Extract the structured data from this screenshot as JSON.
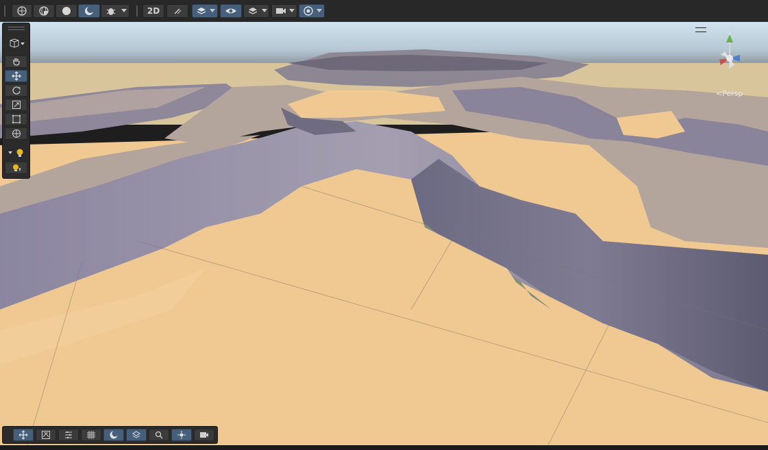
{
  "toolbar": {
    "items": [
      {
        "name": "global-toggle-button",
        "icon": "globe-icon",
        "active": false
      },
      {
        "name": "shading-wireframe-button",
        "icon": "wireframe-sphere-icon",
        "active": false
      },
      {
        "name": "shading-shaded-button",
        "icon": "shaded-sphere-icon",
        "active": false
      },
      {
        "name": "shading-lit-button",
        "icon": "lit-sphere-icon",
        "active": true
      },
      {
        "name": "debug-draw-mode-button",
        "icon": "bug-icon",
        "active": false
      },
      {
        "name": "toggle-2d-button",
        "label": "2D",
        "active": false
      },
      {
        "name": "lighting-toggle-button",
        "icon": "light-off-icon",
        "active": false
      },
      {
        "name": "effects-button",
        "icon": "layers-icon",
        "active": true
      },
      {
        "name": "scene-visibility-button",
        "icon": "eye-icon",
        "active": true
      },
      {
        "name": "layers-dropdown-button",
        "icon": "stack-icon",
        "active": false
      },
      {
        "name": "camera-settings-button",
        "icon": "camera-icon",
        "active": false
      },
      {
        "name": "gizmos-button",
        "icon": "gizmo-globe-icon",
        "active": true
      }
    ]
  },
  "tools_panel": {
    "items": [
      {
        "name": "view-tool",
        "icon": "hand-icon",
        "active": false
      },
      {
        "name": "move-tool",
        "icon": "move-arrows-icon",
        "active": true
      },
      {
        "name": "rotate-tool",
        "icon": "rotate-icon",
        "active": false
      },
      {
        "name": "scale-tool",
        "icon": "scale-icon",
        "active": false
      },
      {
        "name": "rect-tool",
        "icon": "rect-icon",
        "active": false
      },
      {
        "name": "transform-tool",
        "icon": "transform-icon",
        "active": false
      },
      {
        "name": "light-probe-tool",
        "icon": "lightbulb-icon",
        "active": false
      },
      {
        "name": "light-probe-edit-tool",
        "icon": "lightbulb-sparkle-icon",
        "active": false
      }
    ]
  },
  "scene_overlay": {
    "items": [
      {
        "name": "move-overlay-button",
        "icon": "move-arrows-icon",
        "active": true
      },
      {
        "name": "terrain-raise-button",
        "icon": "terrain-icon",
        "active": false
      },
      {
        "name": "sliders-button",
        "icon": "sliders-icon",
        "active": false
      },
      {
        "name": "grid-snap-button",
        "icon": "grid-icon",
        "active": false
      },
      {
        "name": "shading-overlay-button",
        "icon": "lit-sphere-icon",
        "active": true
      },
      {
        "name": "layers-overlay-button",
        "icon": "layers-icon",
        "active": true
      },
      {
        "name": "search-overlay-button",
        "icon": "search-icon",
        "active": false
      },
      {
        "name": "pivot-button",
        "icon": "pivot-icon",
        "active": true
      },
      {
        "name": "camera-overlay-button",
        "icon": "camera-icon",
        "active": false
      }
    ]
  },
  "view": {
    "projection_label": "<Persp",
    "toggle_2d_label": "2D"
  },
  "colors": {
    "sand": "#efc892",
    "cliff": "#8e8aa0",
    "rock_top": "#b3a49c",
    "sky": "#cfe2ee",
    "active": "#46607c"
  }
}
